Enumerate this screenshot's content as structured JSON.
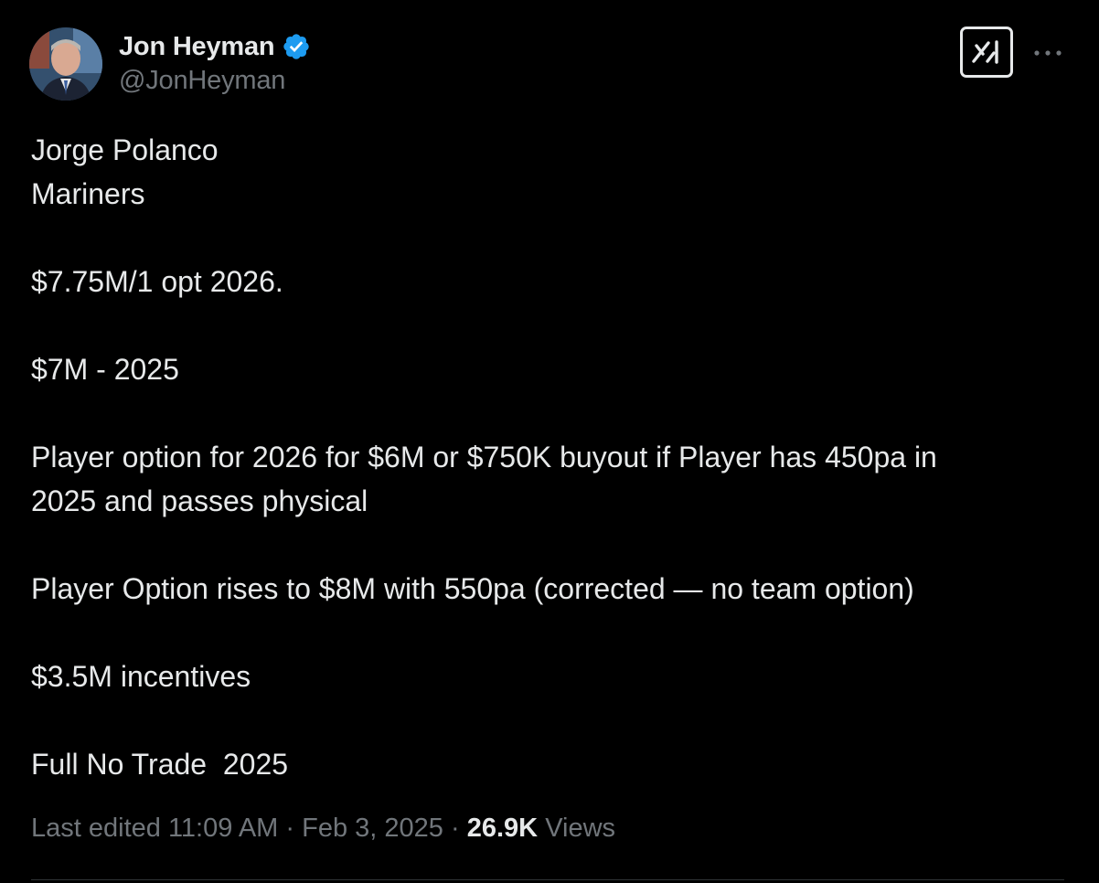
{
  "author": {
    "display_name": "Jon Heyman",
    "handle": "@JonHeyman",
    "verified_icon": "verified-badge-icon"
  },
  "toolbar": {
    "grok_icon": "grok-icon",
    "more_icon": "more-icon"
  },
  "tweet": {
    "lines": [
      "Jorge Polanco",
      "Mariners",
      "",
      "$7.75M/1 opt 2026.",
      "",
      "$7M - 2025",
      "",
      "Player option for 2026 for $6M or $750K buyout if Player has 450pa in",
      "2025 and passes physical",
      "",
      "Player Option rises to $8M with 550pa (corrected — no team option)",
      "",
      "$3.5M incentives",
      "",
      "Full No Trade  2025"
    ]
  },
  "meta": {
    "edited_label": "Last edited",
    "time": "11:09 AM",
    "separator": "·",
    "date": "Feb 3, 2025",
    "views_count": "26.9K",
    "views_label": "Views"
  },
  "colors": {
    "background": "#000000",
    "text": "#e7e9ea",
    "secondary": "#71767b",
    "verified": "#1d9bf0"
  }
}
